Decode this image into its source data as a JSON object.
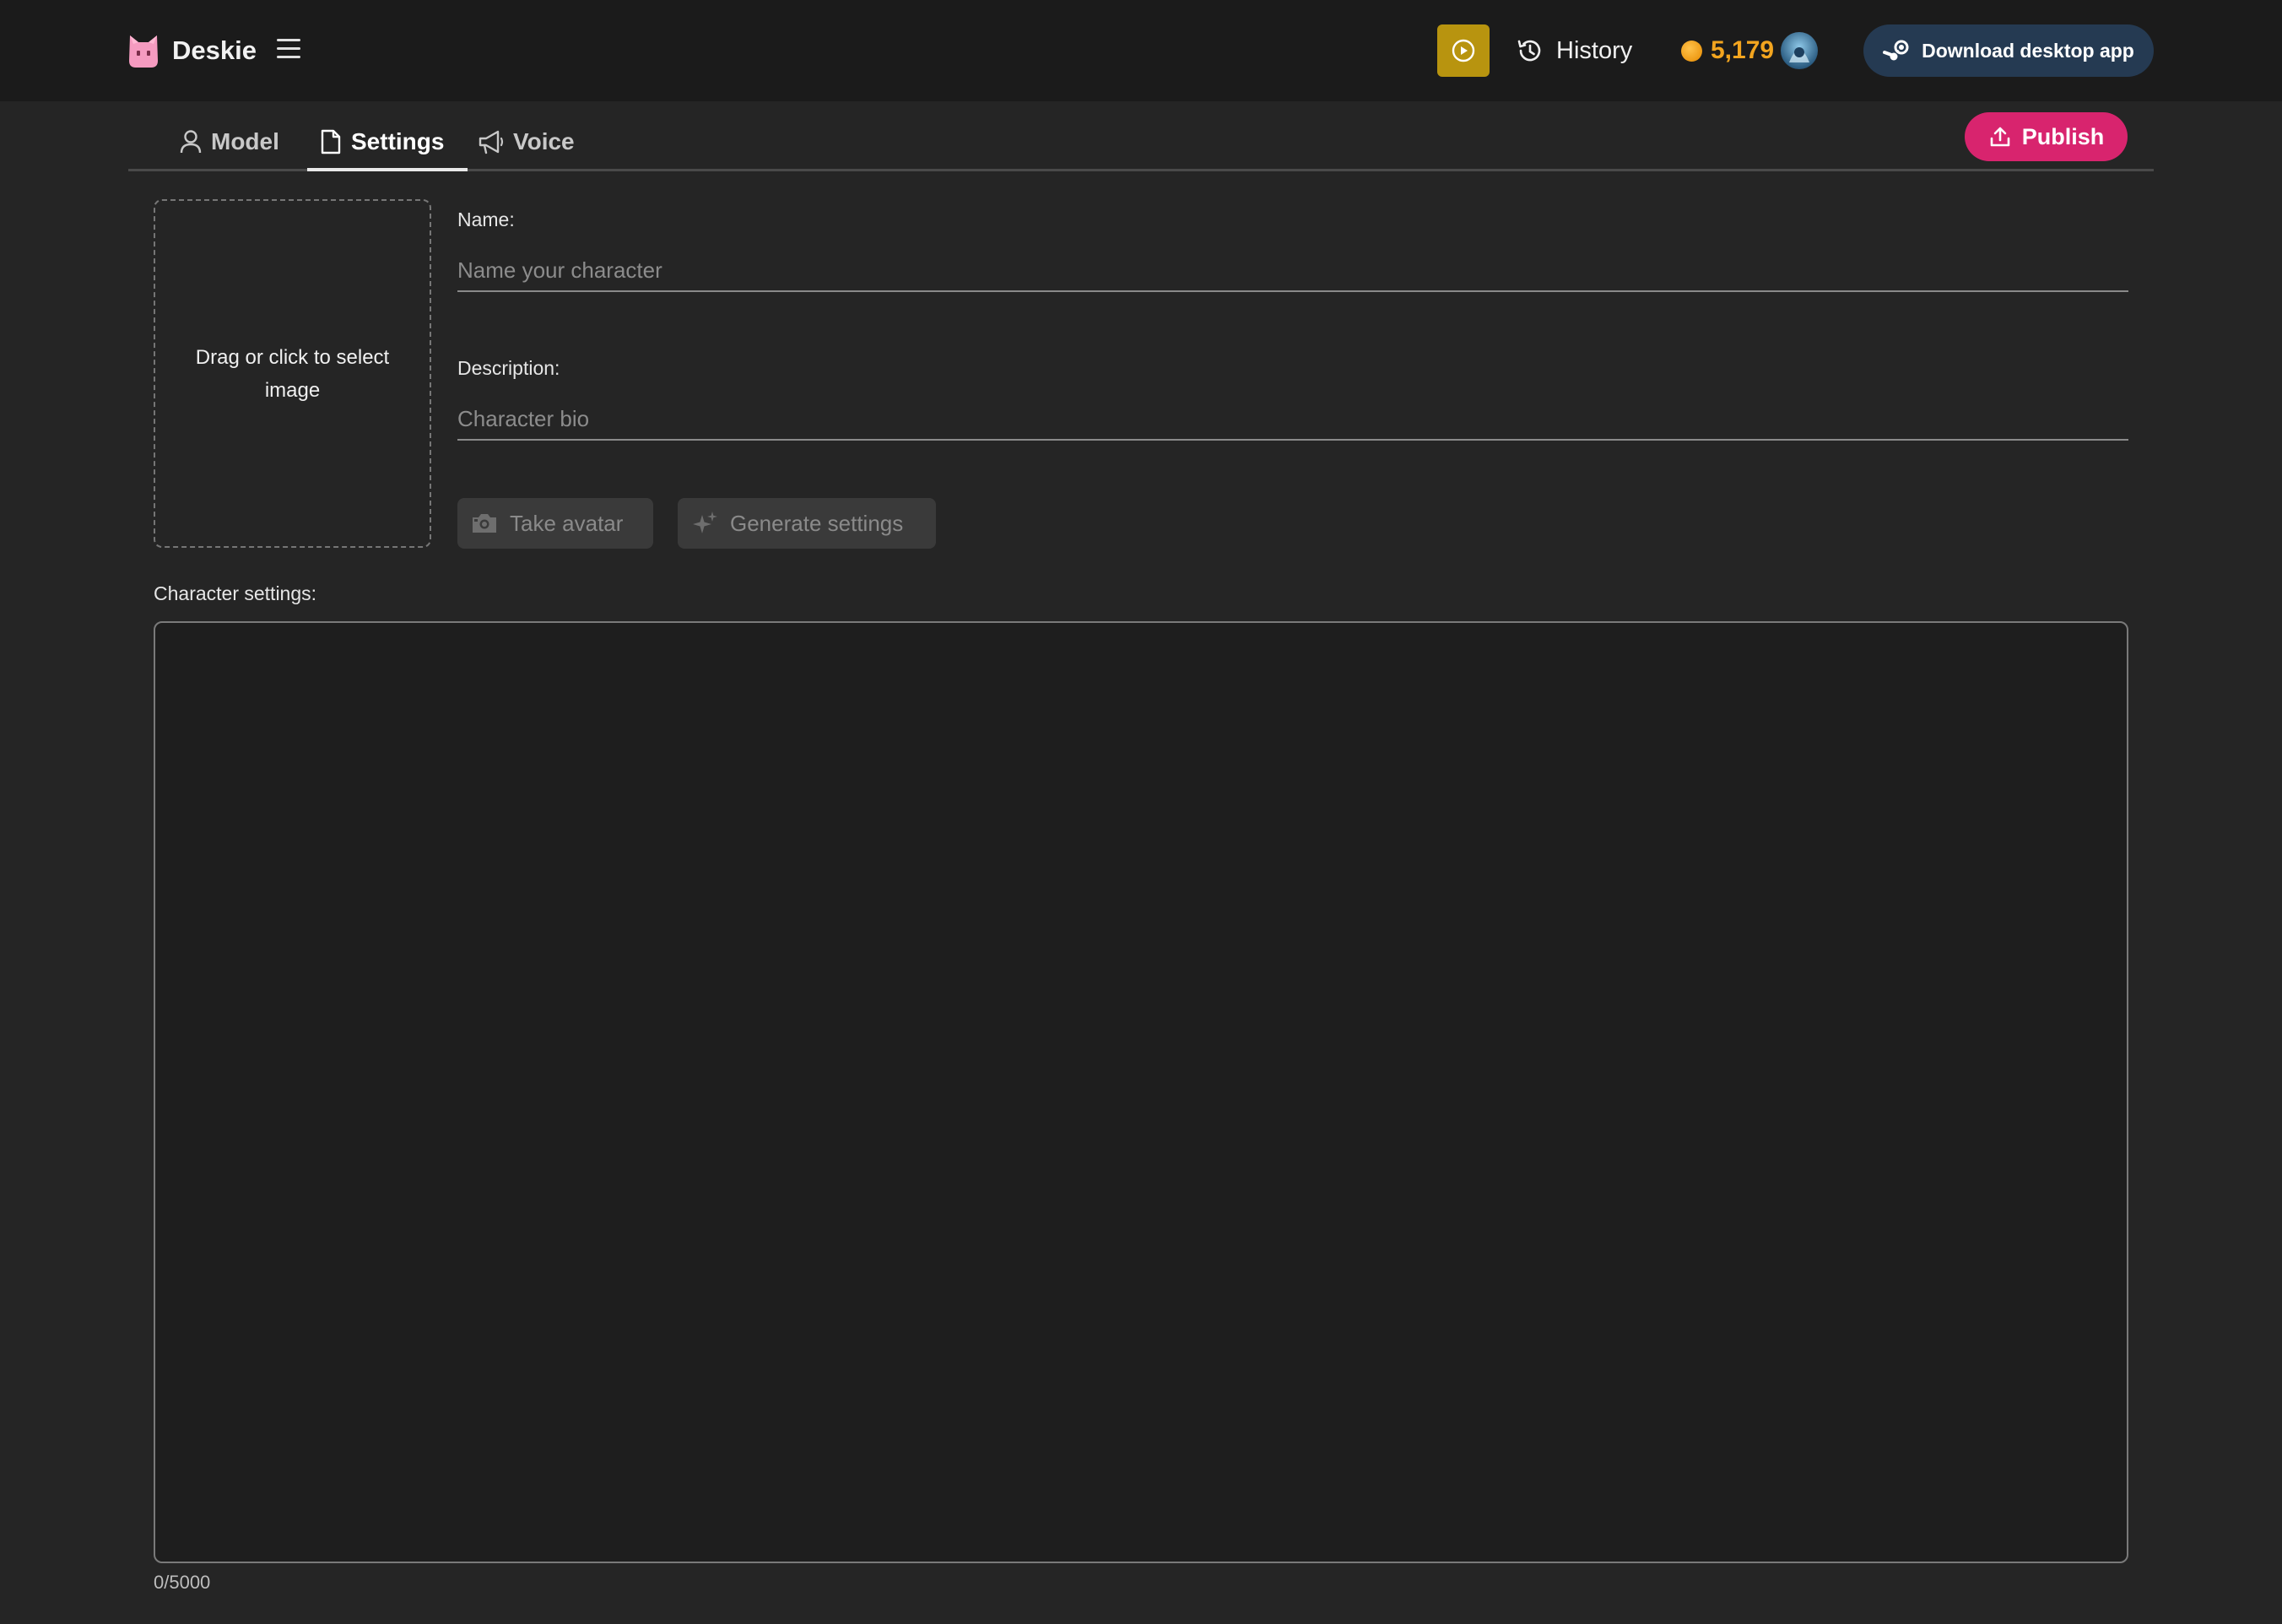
{
  "app": {
    "name": "Deskie"
  },
  "header": {
    "history_label": "History",
    "coins": "5,179",
    "download_label": "Download desktop app"
  },
  "tabs": [
    {
      "label": "Model",
      "icon": "user-icon"
    },
    {
      "label": "Settings",
      "icon": "document-icon",
      "active": true
    },
    {
      "label": "Voice",
      "icon": "megaphone-icon"
    }
  ],
  "publish_label": "Publish",
  "form": {
    "dropzone_text": "Drag or click to select image",
    "name_label": "Name:",
    "name_placeholder": "Name your character",
    "name_value": "",
    "description_label": "Description:",
    "description_placeholder": "Character bio",
    "description_value": "",
    "take_avatar_label": "Take avatar",
    "generate_settings_label": "Generate settings",
    "settings_label": "Character settings:",
    "settings_value": "",
    "char_count": "0/5000"
  },
  "colors": {
    "accent_publish": "#d8246e",
    "coin": "#f3a51f",
    "play_button": "#b8940f",
    "download_button": "#253a52"
  }
}
